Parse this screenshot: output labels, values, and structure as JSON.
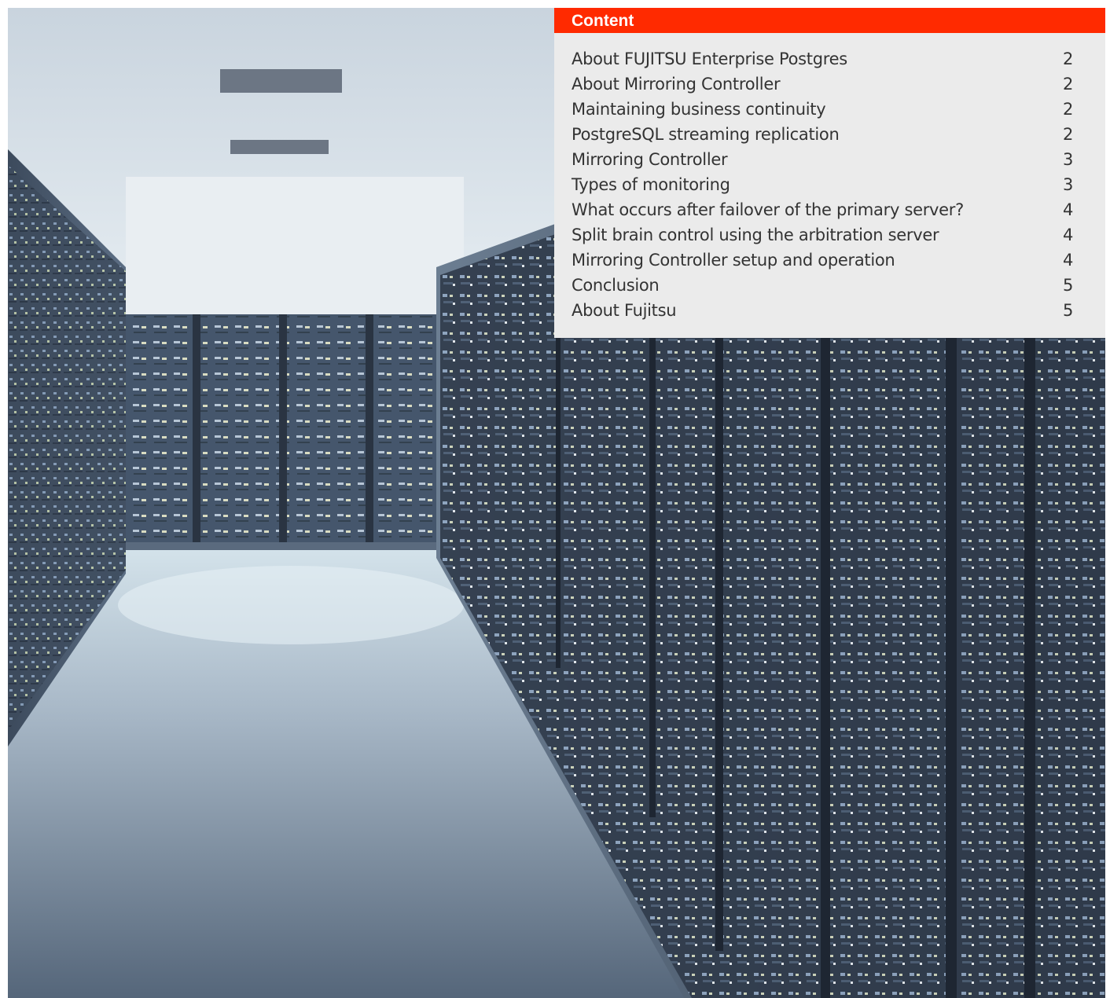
{
  "toc": {
    "header": "Content",
    "items": [
      {
        "title": "About FUJITSU Enterprise Postgres",
        "page": "2"
      },
      {
        "title": "About Mirroring Controller",
        "page": "2"
      },
      {
        "title": "Maintaining business continuity",
        "page": "2"
      },
      {
        "title": "PostgreSQL streaming replication",
        "page": "2"
      },
      {
        "title": "Mirroring Controller",
        "page": "3"
      },
      {
        "title": "Types of monitoring",
        "page": "3"
      },
      {
        "title": "What occurs after failover of the primary server?",
        "page": "4"
      },
      {
        "title": "Split brain control using the arbitration server",
        "page": "4"
      },
      {
        "title": "Mirroring Controller setup and operation",
        "page": "4"
      },
      {
        "title": "Conclusion",
        "page": "5"
      },
      {
        "title": "About Fujitsu",
        "page": "5"
      }
    ]
  },
  "colors": {
    "accent": "#ff2a00",
    "panel": "#ebebeb",
    "text": "#333333"
  }
}
